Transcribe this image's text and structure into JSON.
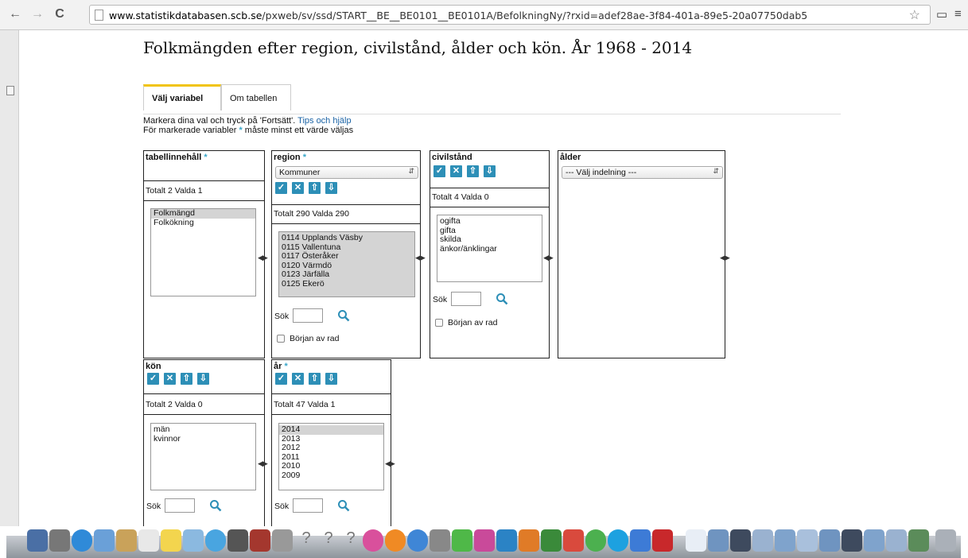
{
  "browser": {
    "url_host": "www.statistikdatabasen.scb.se",
    "url_path": "/pxweb/sv/ssd/START__BE__BE0101__BE0101A/BefolkningNy/?rxid=adef28ae-3f84-401a-89e5-20a07750dab5"
  },
  "page": {
    "title": "Folkmängden efter region, civilstånd, ålder och kön. År 1968 - 2014",
    "tabs": [
      "Välj variabel",
      "Om tabellen"
    ],
    "help_line1_prefix": "Markera dina val och tryck på 'Fortsätt'.",
    "help_link": "Tips och hjälp",
    "help_line2_prefix": "För markerade variabler",
    "help_line2_suffix": "måste minst ett värde väljas",
    "asterisk": "*"
  },
  "labels": {
    "sok": "Sök",
    "borjan_av_rad": "Början av rad"
  },
  "variables": {
    "tabellinnehall": {
      "name": "tabellinnehåll",
      "totalt": "Totalt 2 Valda 1",
      "items": [
        "Folkmängd",
        "Folkökning"
      ]
    },
    "region": {
      "name": "region",
      "selector": "Kommuner",
      "totalt": "Totalt 290 Valda 290",
      "items": [
        "0114 Upplands Väsby",
        "0115 Vallentuna",
        "0117 Österåker",
        "0120 Värmdö",
        "0123 Järfälla",
        "0125 Ekerö"
      ]
    },
    "civilstand": {
      "name": "civilstånd",
      "totalt": "Totalt 4 Valda 0",
      "items": [
        "ogifta",
        "gifta",
        "skilda",
        "änkor/änklingar"
      ]
    },
    "alder": {
      "name": "ålder",
      "selector": "--- Välj indelning ---"
    },
    "kon": {
      "name": "kön",
      "totalt": "Totalt 2 Valda 0",
      "items": [
        "män",
        "kvinnor"
      ]
    },
    "ar": {
      "name": "år",
      "totalt": "Totalt 47 Valda 1",
      "items": [
        "2014",
        "2013",
        "2012",
        "2011",
        "2010",
        "2009"
      ]
    }
  },
  "icons": {
    "check": "checkmark-icon",
    "deselect": "x-icon",
    "up": "sort-up-icon",
    "down": "sort-down-icon",
    "search": "magnifier-icon"
  },
  "colors": {
    "icon_blue": "#2d8fb7",
    "link": "#1b63a5",
    "tab_accent": "#f1c40f",
    "selected_bg": "#d4d4d4"
  }
}
